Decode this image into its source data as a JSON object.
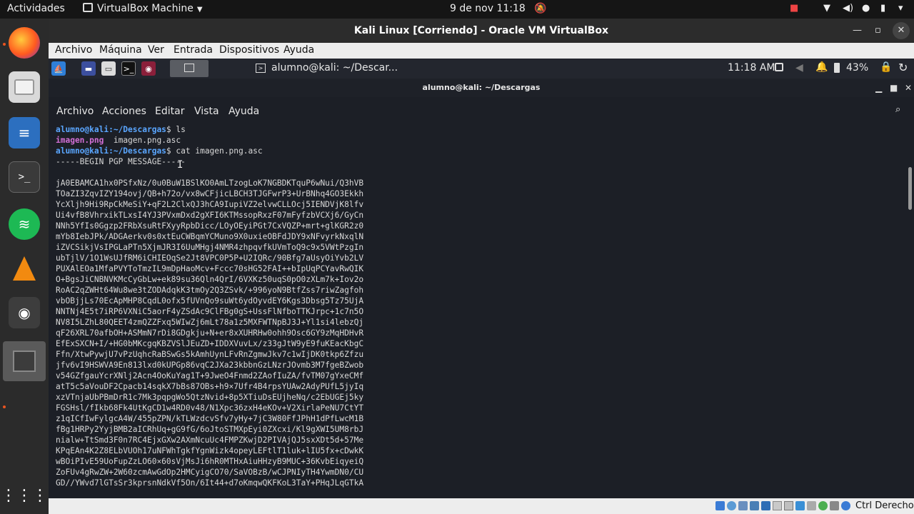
{
  "topbar": {
    "activities": "Actividades",
    "app_name": "VirtualBox Machine",
    "clock": "9 de nov  11:18"
  },
  "vbox": {
    "title": "Kali Linux [Corriendo] - Oracle VM VirtualBox",
    "menu": [
      "Archivo",
      "Máquina",
      "Ver",
      "Entrada",
      "Dispositivos",
      "Ayuda"
    ],
    "status_host_key": "Ctrl Derecho"
  },
  "kali_panel": {
    "task_title": "alumno@kali: ~/Descar...",
    "clock": "11:18 AM",
    "battery": "43%"
  },
  "terminal": {
    "title": "alumno@kali: ~/Descargas",
    "menu": [
      "Archivo",
      "Acciones",
      "Editar",
      "Vista",
      "Ayuda"
    ],
    "prompt_user": "alumno@kali",
    "prompt_path": ":~/Descargas",
    "cmd1": "ls",
    "file1": "imagen.png",
    "file2": "imagen.png.asc",
    "cmd2": "cat imagen.png.asc",
    "pgp_begin": "-----BEGIN PGP MESSAGE-----",
    "lines": [
      "jA0EBAMCA1hx0PSfxNz/0u0BuW1BSlKO0AmLTzogLoK7NGBDKTquP6wNui/Q3hVB",
      "TOaZI3ZqvIZY194ovj/QB+h72o/vx8wCFjicLBCH3TJGFwrP3+UrBNhq4GO3Ekkh",
      "YcXljh9Hi9RpCkMeSiY+qF2L2ClxQJ3hCA9IupiVZ2elvwCLLOcj5IENDVjK8lfv",
      "Ui4vfB8VhrxikTLxsI4YJ3PVxmDxd2gXFI6KTMssopRxzF07mFyfzbVCXj6/GyCn",
      "NNh5YfIs0Ggzp2FRbXsuRtFXyyRpbDicc/LOyOEyiPGt7CxVQZP+mrt+glKGR2z0",
      "mYb8IebJPk/ADGAerkv0s0xtEuCWBqmYCMuno9X0uxieOBFdJDY9xNFvyrkNxqlN",
      "iZVCSikjVsIPGLaPTn5XjmJR3I6UuMHgj4NMR4zhpqvfkUVmToQ9c9x5VWtPzgIn",
      "ubTjlV/1O1WsUJfRM6iCHIEOqSe2Jt8VPC0P5P+U2IQRc/90Bfg7aUsyOiYvb2LV",
      "PUXAlEOa1MfaPVYToTmzIL9mDpHaoMcv+Fccc70sHG52FAI++bIpUqPCYavRwQIK",
      "O+BgsJiCNBNVKMcCyGbLw+ek89su36Qln4QrI/6VXKz50uqS0pO0zXLm7k+Iov2o",
      "RoAC2qZWHt64Wu8we3tZODAdqkK3tmOy2Q3ZSvk/+996yoN9BtfZss7riwZagfoh",
      "vbOBjjLs70EcApMHP8CqdL0ofx5fUVnQo9suWt6ydOyvdEY6Kgs3Dbsg5Tz75UjA",
      "NNTNj4E5t7iRP6VXNiC5aorF4yZSdAc9ClFBg0gS+UssFlNfboTTKJrpc+1c7n5O",
      "NV8I5LZhL80QEET4zmQZZFxq5WIwZj6mLt78a1z5MXFWTNpBJ3J+Yl1si4lebzQj",
      "qF26XRL70afbOH+ASMmN7rDi8GDgkju+N+er8xXUHRHw0ohh9Osc6GY9zMqHDHvR",
      "EfExSXCN+I/+HG0bMKcgqKBZVSlJEuZD+IDDXVuvLx/z33gJtW9yE9fuKEacKbgC",
      "Ffn/XtwPywjU7vPzUqhcRaBSwGs5kAmhUynLFvRnZgmwJkv7c1wIjDK0tkp6Zfzu",
      "jfv6vI9HSWVA9En813lxd0kUPGp86vqC2JXa23kbbnGzLNzrJOvmb3M7fgeBZwob",
      "v54GZfgauYcrXNlj2Acn4OoKuYag1T+9JweO4Fnmd2ZAofIuZA/fvTM07gYxeCMf",
      "atT5c5aVouDF2Cpacb14sqkX7bBs87OBs+h9×7Ufr4B4rpsYUAw2AdyPUfL5jyIq",
      "xzVTnjaUbPBmDrR1c7Mk3pqpgWo5QtzNvid+8p5XTiuDsEUjheNq/c2EbUGEj5ky",
      "FGSHsl/fIkb68Fk4UtKgCD1w4RD0v48/N1Xpc36zxH4eKOv+V2XirlaPeNU7CtYT",
      "z1qICfIwFylgcA4W/455pZPN/kTLWzdcvSfv7yHy+7jC3W80FfJPhH1dPfLwcM1B",
      "fBg1HRPy2YyjBMB2aICRhUq+gG9fG/6oJtoSTMXpEyi0ZXcxi/Kl9gXWI5UM8rbJ",
      "nialw+TtSmd3F0n7RC4EjxGXw2AXmNcuUc4FMPZKwjD2PIVAjQJ5sxXDt5d+57Me",
      "KPqEAn4K2Z8ELbVUOh17uNFWhTgkfYgnWizk4opeyLEFtlT1luk+lIU5fx+cDwkK",
      "wBOiPIvE59UoFupZzLO60×60sVjMsJi6hR0MTHxAiuHHzyB9MUC+36KvbEiqyeiQ",
      "ZoFUv4gRwZW+2W60zcmAwGdOp2HMCyigCO70/SaVOBzB/wCJPNIyTH4YwmDN0/CU",
      "GD//YWvd7lGTsSr3kprsnNdkVf5On/6It44+d7oKmqwQKFKoL3TaY+PHqJLqGTkA"
    ]
  }
}
